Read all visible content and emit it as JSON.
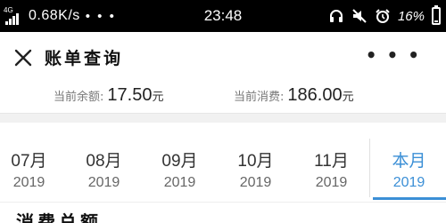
{
  "status_bar": {
    "network_type": "4G",
    "speed": "0.68K/s",
    "more_dots": "• • •",
    "time": "23:48",
    "battery_percent": "16%",
    "battery_level": 0.16,
    "icons": [
      "signal-icon",
      "headset-icon",
      "mute-icon",
      "alarm-icon",
      "battery-icon"
    ]
  },
  "app_bar": {
    "title": "账单查询",
    "close_icon": "close-icon",
    "more_label": "• • •"
  },
  "balance": {
    "remaining_label": "当前余额:",
    "remaining_value": "17.50",
    "remaining_unit": "元",
    "spent_label": "当前消费:",
    "spent_value": "186.00",
    "spent_unit": "元"
  },
  "months": [
    {
      "label": "07月",
      "year": "2019",
      "active": false
    },
    {
      "label": "08月",
      "year": "2019",
      "active": false
    },
    {
      "label": "09月",
      "year": "2019",
      "active": false
    },
    {
      "label": "10月",
      "year": "2019",
      "active": false
    },
    {
      "label": "11月",
      "year": "2019",
      "active": false
    },
    {
      "label": "本月",
      "year": "2019",
      "active": true
    }
  ],
  "colors": {
    "accent": "#3b8fd6",
    "status_bar": "#000000"
  },
  "section": {
    "title": "消费总额"
  }
}
